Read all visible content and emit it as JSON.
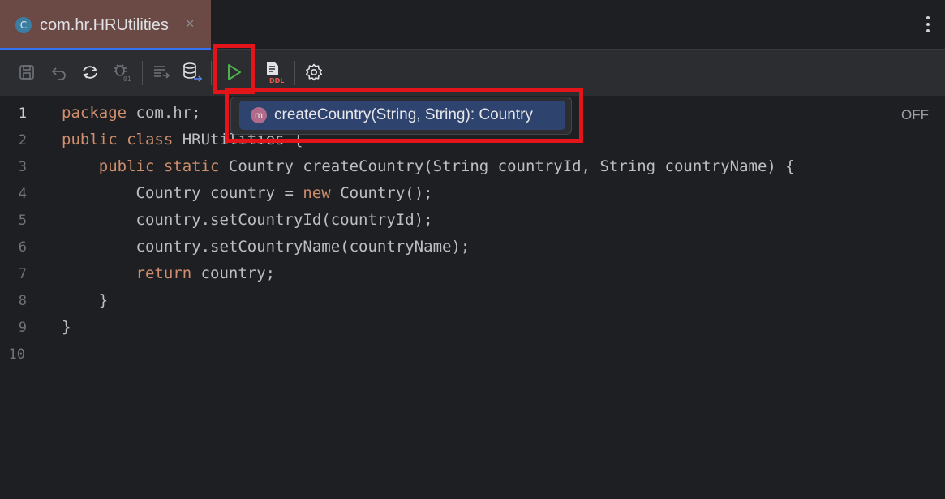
{
  "tab": {
    "title": "com.hr.HRUtilities",
    "icon_letter": "C",
    "close_glyph": "×"
  },
  "toolbar": {
    "icons": [
      "save-icon",
      "revert-icon",
      "sync-icon",
      "debug-bug-icon",
      "format-code-icon",
      "database-deploy-icon",
      "run-icon",
      "ddl-icon",
      "settings-icon"
    ],
    "ddl_label": "DDL",
    "run_color": "#4fb04f"
  },
  "editor": {
    "status": "OFF",
    "line_numbers": [
      "1",
      "2",
      "3",
      "4",
      "5",
      "6",
      "7",
      "8",
      "9",
      "10"
    ],
    "lines": [
      {
        "kw": "package",
        "rest": " com.hr;"
      },
      {
        "kw": "public class",
        "rest": " HRUtilities {"
      },
      {
        "indent": "    ",
        "kw": "public static",
        "rest": " Country createCountry(String countryId, String countryName) {"
      },
      {
        "indent": "        ",
        "pre": "Country country = ",
        "kw": "new",
        "rest": " Country();"
      },
      {
        "indent": "        ",
        "rest": "country.setCountryId(countryId);"
      },
      {
        "indent": "        ",
        "rest": "country.setCountryName(countryName);"
      },
      {
        "indent": "        ",
        "kw": "return",
        "rest": " country;"
      },
      {
        "indent": "    ",
        "rest": "}"
      },
      {
        "rest": "}"
      },
      {
        "rest": ""
      }
    ]
  },
  "popup": {
    "method_icon_letter": "m",
    "item": "createCountry(String, String): Country"
  },
  "colors": {
    "highlight": "#e3141a",
    "keyword": "#cf8e6d",
    "background": "#1e1f22"
  }
}
